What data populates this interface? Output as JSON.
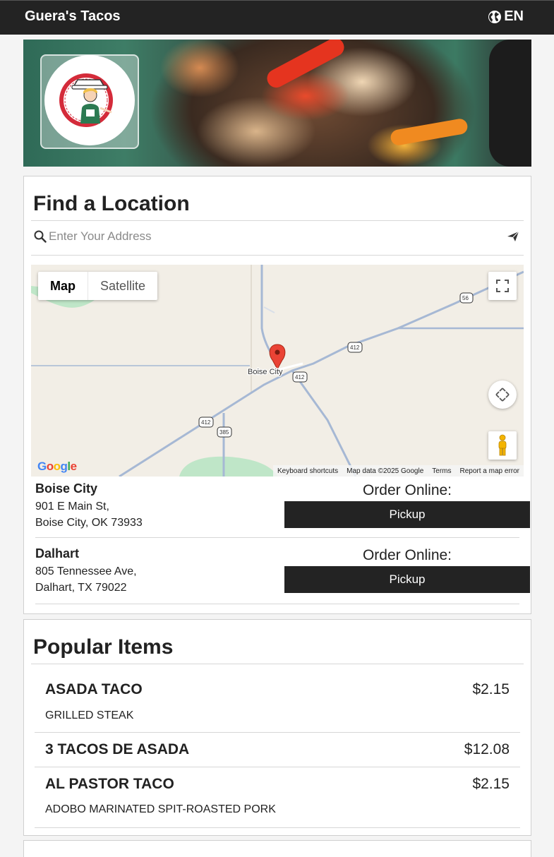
{
  "header": {
    "brand": "Guera's Tacos",
    "language": "EN"
  },
  "hero": {
    "logo_text": "Guera's Tacos"
  },
  "find_location": {
    "title": "Find a Location",
    "search_placeholder": "Enter Your Address",
    "map": {
      "tabs": [
        "Map",
        "Satellite"
      ],
      "place_label": "Boise City",
      "road_shields": [
        "56",
        "412",
        "412",
        "412",
        "385"
      ],
      "footer": [
        "Keyboard shortcuts",
        "Map data ©2025 Google",
        "Terms",
        "Report a map error"
      ],
      "logo": "Google"
    },
    "locations": [
      {
        "name": "Boise City",
        "address_line1": "901 E Main St,",
        "address_line2": "Boise City, OK 73933",
        "order_label": "Order Online:",
        "button_label": "Pickup"
      },
      {
        "name": "Dalhart",
        "address_line1": "805 Tennessee Ave,",
        "address_line2": "Dalhart, TX 79022",
        "order_label": "Order Online:",
        "button_label": "Pickup"
      }
    ]
  },
  "popular": {
    "title": "Popular Items",
    "items": [
      {
        "name": "ASADA TACO",
        "price": "$2.15",
        "description": "GRILLED STEAK"
      },
      {
        "name": "3 TACOS DE ASADA",
        "price": "$12.08",
        "description": ""
      },
      {
        "name": "AL PASTOR TACO",
        "price": "$2.15",
        "description": "ADOBO MARINATED SPIT-ROASTED PORK"
      }
    ]
  }
}
